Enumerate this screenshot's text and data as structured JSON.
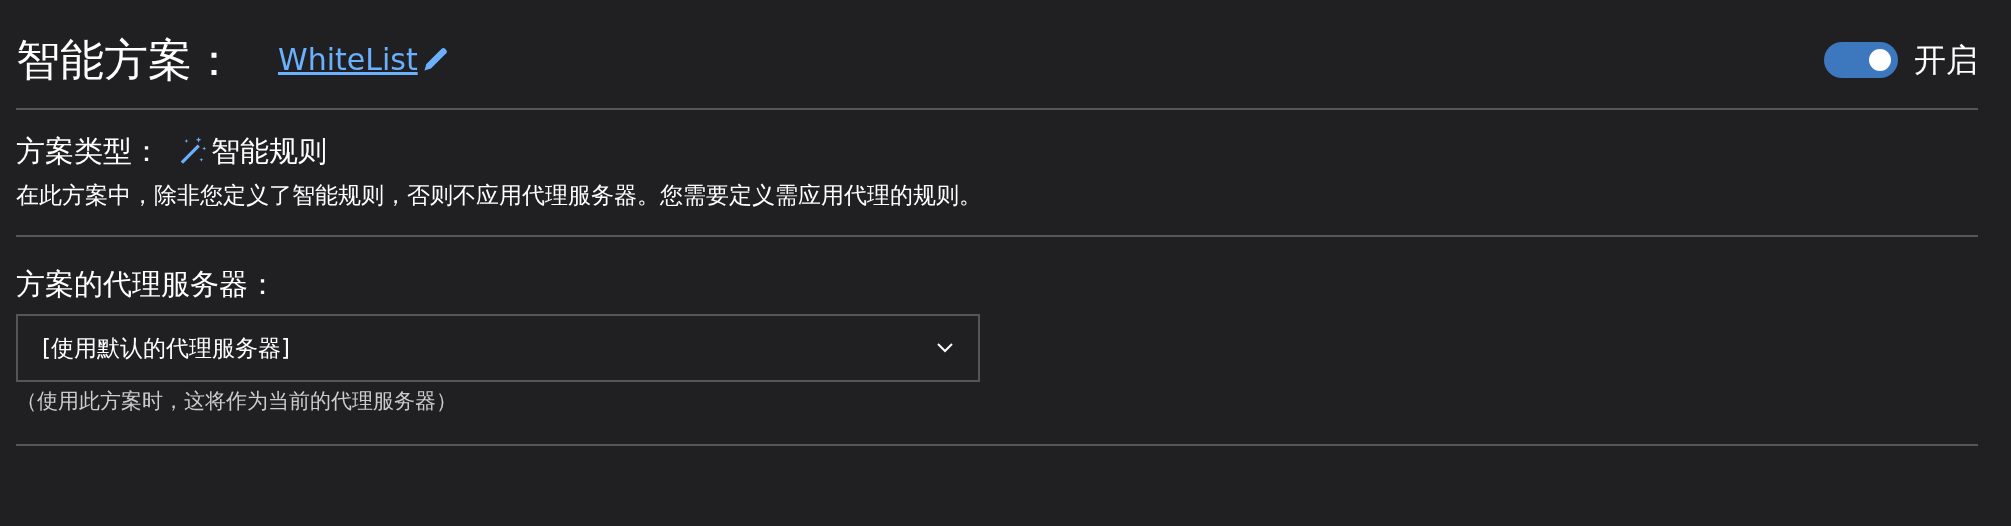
{
  "header": {
    "title": "智能方案：",
    "name_link": "WhiteList",
    "enabled": true,
    "enabled_label": "开启"
  },
  "profile_type": {
    "label": "方案类型：",
    "value": "智能规则",
    "description": "在此方案中，除非您定义了智能规则，否则不应用代理服务器。您需要定义需应用代理的规则。"
  },
  "proxy_server": {
    "label": "方案的代理服务器：",
    "value": "[使用默认的代理服务器]",
    "help": "（使用此方案时，这将作为当前的代理服务器）"
  }
}
